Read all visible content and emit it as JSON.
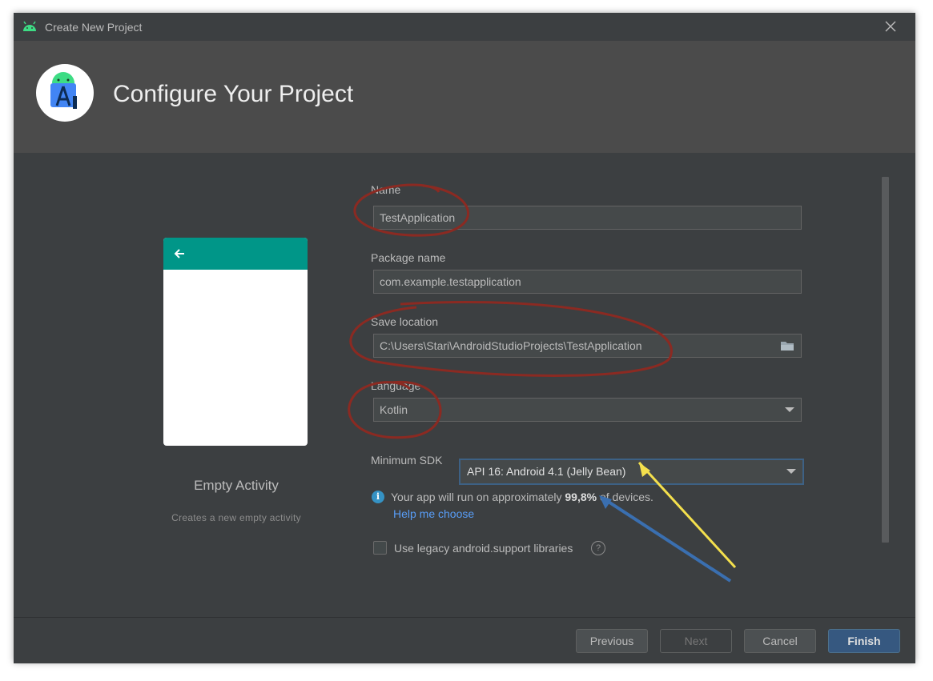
{
  "window": {
    "title": "Create New Project"
  },
  "header": {
    "title": "Configure Your Project"
  },
  "template": {
    "name": "Empty Activity",
    "description": "Creates a new empty activity"
  },
  "form": {
    "name": {
      "label": "Name",
      "value": "TestApplication"
    },
    "package": {
      "label": "Package name",
      "value": "com.example.testapplication"
    },
    "location": {
      "label": "Save location",
      "value": "C:\\Users\\Stari\\AndroidStudioProjects\\TestApplication"
    },
    "language": {
      "label": "Language",
      "value": "Kotlin"
    },
    "min_sdk": {
      "label": "Minimum SDK",
      "value": "API 16: Android 4.1 (Jelly Bean)"
    },
    "info": {
      "prefix": "Your app will run on approximately ",
      "percent": "99,8%",
      "suffix": " of devices."
    },
    "help_link": "Help me choose",
    "legacy": {
      "label": "Use legacy android.support libraries",
      "checked": false
    }
  },
  "buttons": {
    "previous": "Previous",
    "next": "Next",
    "cancel": "Cancel",
    "finish": "Finish"
  },
  "colors": {
    "annotation_red": "#8b2a22",
    "arrow_yellow": "#f4e04d",
    "arrow_blue": "#3a6fb0",
    "accent": "#009688"
  }
}
